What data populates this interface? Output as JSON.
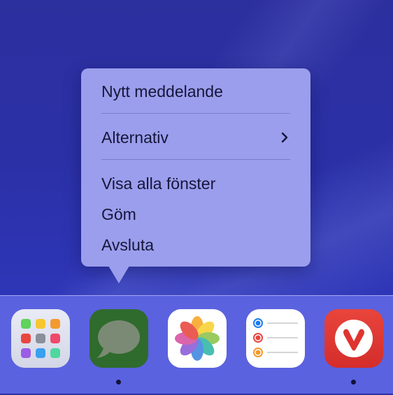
{
  "context_menu": {
    "items": [
      {
        "label": "Nytt meddelande"
      },
      {
        "label": "Alternativ",
        "has_submenu": true
      },
      {
        "label": "Visa alla fönster"
      },
      {
        "label": "Göm"
      },
      {
        "label": "Avsluta"
      }
    ]
  },
  "dock": {
    "apps": [
      {
        "name": "Launchpad",
        "icon": "launchpad-icon",
        "running": false
      },
      {
        "name": "Messages",
        "icon": "messages-icon",
        "running": true
      },
      {
        "name": "Photos",
        "icon": "photos-icon",
        "running": false
      },
      {
        "name": "Reminders",
        "icon": "reminders-icon",
        "running": false
      },
      {
        "name": "Vivaldi",
        "icon": "vivaldi-icon",
        "running": true
      }
    ]
  },
  "colors": {
    "desktop": "#2b30a6",
    "menu_background": "#9b9eec",
    "dock_background": "#5a62df",
    "messages_icon": "#2f6b2d",
    "vivaldi_icon": "#e8453c"
  }
}
